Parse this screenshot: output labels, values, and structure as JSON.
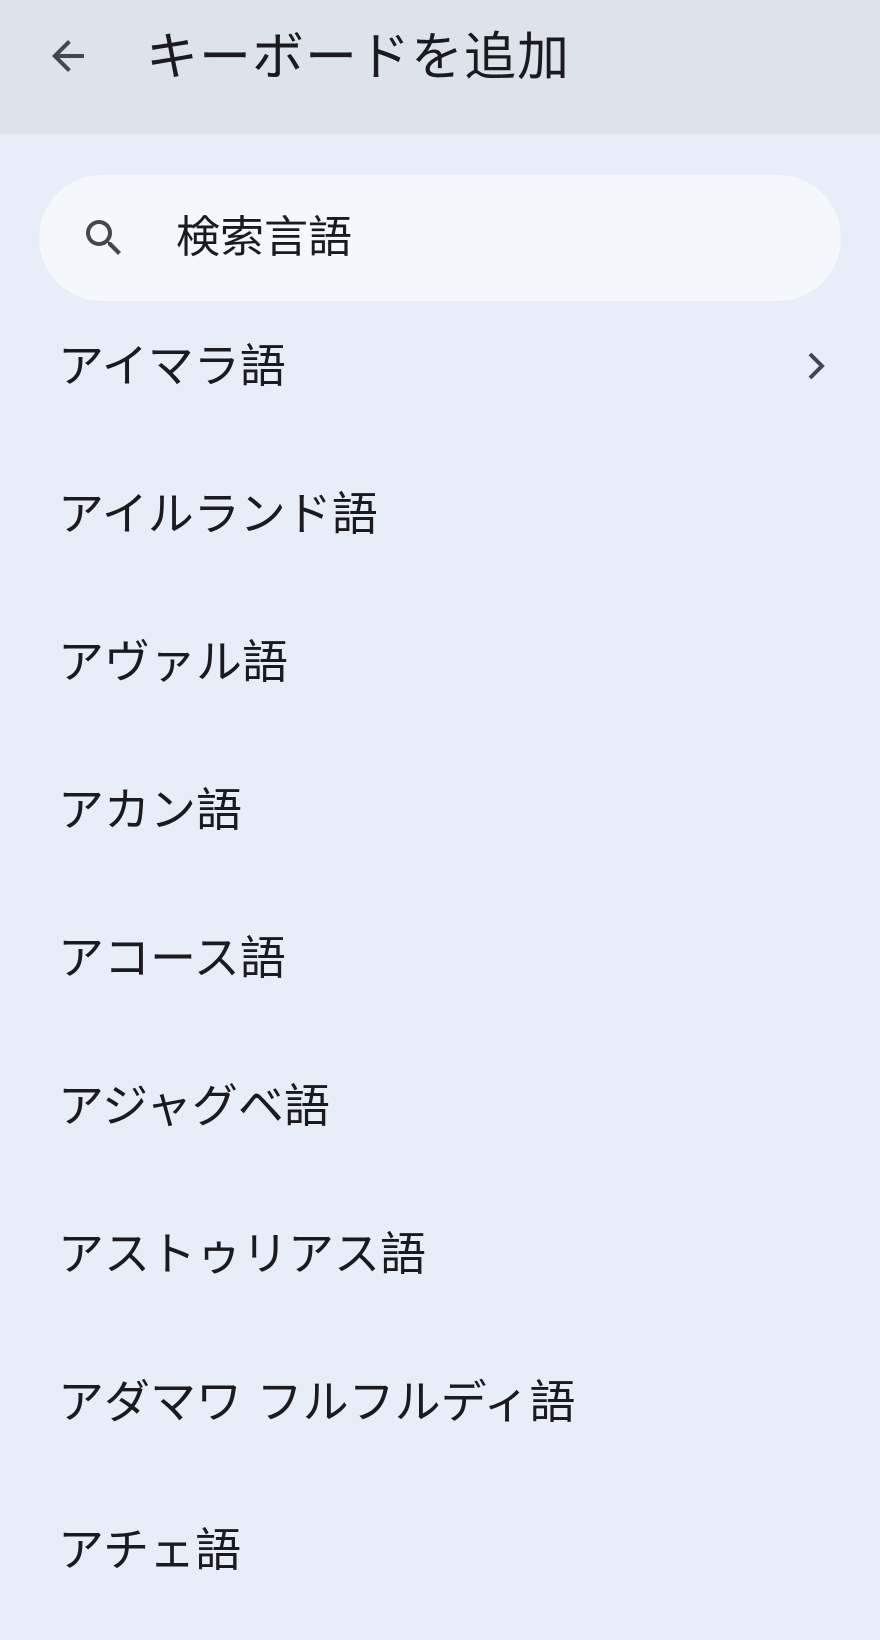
{
  "header": {
    "title": "キーボードを追加",
    "back_icon": "arrow-back-icon"
  },
  "search": {
    "placeholder": "検索言語",
    "icon": "search-icon"
  },
  "languages": [
    {
      "label": "アイマラ語",
      "has_chevron": true
    },
    {
      "label": "アイルランド語"
    },
    {
      "label": "アヴァル語"
    },
    {
      "label": "アカン語"
    },
    {
      "label": "アコース語"
    },
    {
      "label": "アジャグベ語"
    },
    {
      "label": "アストゥリアス語"
    },
    {
      "label": "アダマワ フルフルディ語"
    },
    {
      "label": "アチェ語"
    }
  ],
  "colors": {
    "background": "#e7eef8",
    "app_bar": "#dce3eb",
    "search_bar": "#f4f8fd",
    "text": "#1b1b1f",
    "icon": "#44474f"
  }
}
